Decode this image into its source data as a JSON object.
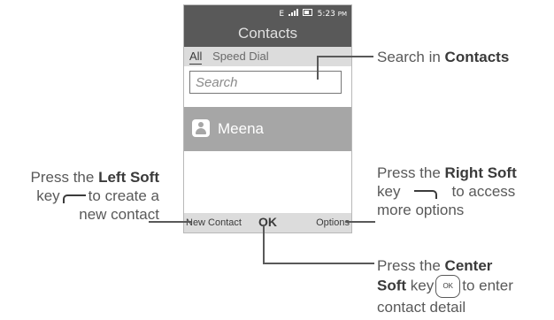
{
  "status_bar": {
    "network": "E",
    "time": "5:23",
    "ampm": "PM"
  },
  "title": "Contacts",
  "tabs": [
    {
      "label": "All",
      "active": true
    },
    {
      "label": "Speed Dial",
      "active": false
    }
  ],
  "search": {
    "placeholder": "Search"
  },
  "contacts": [
    {
      "name": "Meena",
      "icon": "person-icon"
    }
  ],
  "softkeys": {
    "left": "New Contact",
    "center": "OK",
    "right": "Options"
  },
  "callouts": {
    "search": {
      "text": "Search in ",
      "bold": "Contacts"
    },
    "left": {
      "line1_pre": "Press the ",
      "line1_bold": "Left Soft",
      "line2_pre": "key",
      "line2_post": "to create a",
      "line3": "new contact"
    },
    "right": {
      "line1_pre": "Press the ",
      "line1_bold": "Right Soft",
      "line2_pre": "key",
      "line2_post": "to access",
      "line3": "more options"
    },
    "center": {
      "line1_pre": "Press the ",
      "line1_bold": "Center",
      "line2_bold": "Soft",
      "line2_pre": " key",
      "ok_glyph": "OK",
      "line2_post": "to enter",
      "line3": "contact detail"
    }
  },
  "colors": {
    "bar": "#595959",
    "highlight": "#a6a6a6",
    "softkey_bg": "#dcdcdc"
  }
}
